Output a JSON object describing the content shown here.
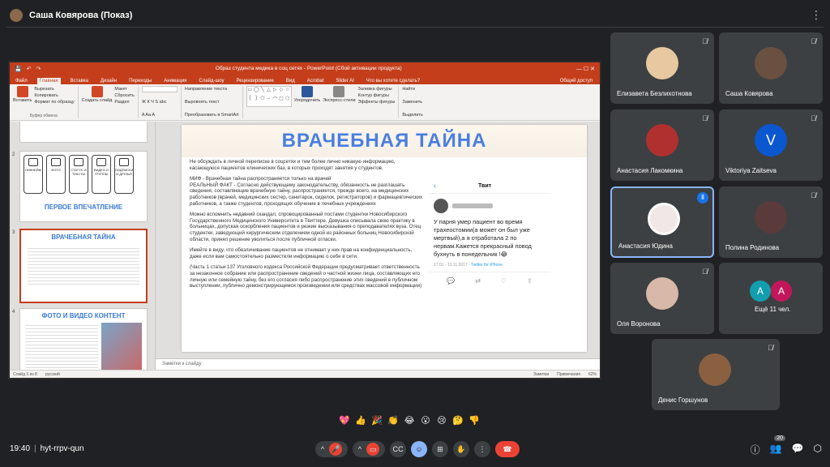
{
  "presenter": {
    "name": "Саша Ковярова (Показ)"
  },
  "meeting": {
    "time": "19:40",
    "code": "hyt-rrpv-qun",
    "participant_count": "20"
  },
  "ppt": {
    "title": "Образ студента медика в соц сетях - PowerPoint (Сбой активации продукта)",
    "tabs": [
      "Файл",
      "Главная",
      "Вставка",
      "Дизайн",
      "Переходы",
      "Анимация",
      "Слайд-шоу",
      "Рецензирование",
      "Вид",
      "Acrobat",
      "Slider AI",
      "Что вы хотите сделать?"
    ],
    "share_label": "Общий доступ",
    "ribbon": {
      "paste": "Вставить",
      "cut": "Вырезать",
      "copy": "Копировать",
      "format": "Формат по образцу",
      "clipboard": "Буфер обмена",
      "new_slide": "Создать слайд",
      "layout": "Макет",
      "reset": "Сбросить",
      "section": "Раздел",
      "text_dir": "Направление текста",
      "align_text": "Выровнять текст",
      "smartart": "Преобразовать в SmartArt",
      "arrange": "Упорядочить",
      "quick_styles": "Экспресс-стили",
      "fill": "Заливка фигуры",
      "outline": "Контур фигуры",
      "effects": "Эффекты фигуры",
      "find": "Найти",
      "replace": "Заменить",
      "select": "Выделить"
    },
    "thumbs": {
      "t2_title": "ПЕРВОЕ ВПЕЧАТЛЕНИЕ",
      "t2_icons": [
        "НИКНЕЙМ",
        "ФОТО",
        "СТАТУС И ТЕКСТЫ",
        "ВИДЕО И ГРУППЫ",
        "ПОДПИСКИ И ДРУЗЬЯ"
      ],
      "t3_title": "ВРАЧЕБНАЯ ТАЙНА",
      "t4_title": "ФОТО И ВИДЕО КОНТЕНТ",
      "nums": [
        "2",
        "3",
        "4"
      ]
    },
    "slide": {
      "title": "ВРАЧЕБНАЯ ТАЙНА",
      "p1": "Не обсуждать в личной переписке в соцсетях и тем более лично никакую информацию, касающуюся пациентов клинических баз, в которых проходят занятия у студентов.",
      "p2": "МИФ - Врачебная тайна распространяется только на врачей\nРЕАЛЬНЫЙ ФАКТ - Согласно действующему законодательству, обязанность не разглашать сведения, составляющие врачебную тайну, распространяется, прежде всего, на медицинских работников (врачей, медицинских сестер, санитарок, сиделок, регистраторов) и фармацевтических работников, а также студентов, проходящих обучение в лечебных учреждениях",
      "p3": "Можно вспомнить недавний скандал, спровоцированный постами студентки Новосибирского Государственного Медицинского Университета в Твиттере. Девушка описывала свою практику в больницах, допуская оскорбления пациентов и резкие высказывания о преподавателях вуза. Отец студентки, заведующий хирургическим отделением одной из районных больниц Новосибирской области, принял решение уволиться после публичной огласки.",
      "p4": "Имейте в виду, что обезличивание пациентов не отнимает у них прав на конфиденциальность, даже если вам самостоятельно разместили информацию о себе в сети.",
      "p5": "(Часть 1 статьи 137 Уголовного кодекса Российской Федерации предусматривает ответственность за незаконное собрание или распространение сведений о частной жизни лица, составляющих его личную или семейную тайну, без его согласия либо распространение этих сведений в публичном выступлении, публично демонстрирующемся произведении или средствах массовой информации)"
    },
    "tweet": {
      "header": "Твит",
      "body": "У парня умер пациент во время трахеостомии(а может он был уже мертвый),а я отработала 2 по нервам.Кажется прекрасный повод бухнуть в понедельник !😂",
      "date": "17:01 - 13.11.2017 ·",
      "source": "Twitter for iPhone"
    },
    "notes": "Заметки к слайду",
    "status": {
      "slide": "Слайд 3 из 8",
      "lang": "русский",
      "notes": "Заметки",
      "comments": "Примечания",
      "zoom": "62%"
    }
  },
  "participants": [
    {
      "name": "Елизавета Безлихотнова",
      "initial": "",
      "color": "#e7c8a0"
    },
    {
      "name": "Саша Ковярова",
      "initial": "",
      "color": "#6a5040"
    },
    {
      "name": "Анастасия Лакомкина",
      "initial": "",
      "color": "#b03030"
    },
    {
      "name": "Viktoriya Zaitseva",
      "initial": "V",
      "color": "#0b57d0"
    },
    {
      "name": "Анастасия Юдина",
      "initial": "",
      "color": "#f0e8e6"
    },
    {
      "name": "Полина Родинова",
      "initial": "",
      "color": "#5a3a3a"
    },
    {
      "name": "Оля Воронова",
      "initial": "",
      "color": "#d8b8a8"
    },
    {
      "name": "Ещё 11 чел.",
      "initial": "",
      "color": ""
    },
    {
      "name": "Денис Горшунов",
      "initial": "",
      "color": "#8a6040"
    }
  ],
  "more_avatars": [
    "A",
    "A"
  ],
  "reactions": [
    "💖",
    "👍",
    "🎉",
    "👏",
    "😂",
    "😮",
    "😢",
    "🤔",
    "👎"
  ]
}
